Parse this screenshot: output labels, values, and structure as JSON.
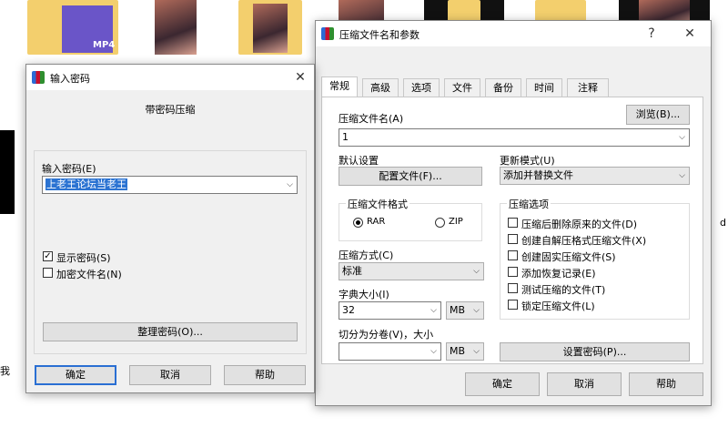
{
  "desktop": {
    "file_label": "MP4",
    "side_chars": [
      "d",
      "我"
    ]
  },
  "password_dialog": {
    "title": "输入密码",
    "heading": "带密码压缩",
    "password_label": "输入密码(E)",
    "password_value": "上老王论坛当老王",
    "show_password_label": "显示密码(S)",
    "show_password_checked": true,
    "encrypt_names_label": "加密文件名(N)",
    "encrypt_names_checked": false,
    "organize_button": "整理密码(O)...",
    "ok_button": "确定",
    "cancel_button": "取消",
    "help_button": "帮助",
    "close_glyph": "✕"
  },
  "archive_dialog": {
    "title": "压缩文件名和参数",
    "help_glyph": "?",
    "close_glyph": "✕",
    "tabs": [
      "常规",
      "高级",
      "选项",
      "文件",
      "备份",
      "时间",
      "注释"
    ],
    "archive_name_label": "压缩文件名(A)",
    "browse_button": "浏览(B)...",
    "archive_name_value": "1",
    "default_settings_label": "默认设置",
    "profiles_button": "配置文件(F)...",
    "update_mode_label": "更新模式(U)",
    "update_mode_value": "添加并替换文件",
    "format_group_label": "压缩文件格式",
    "format_rar": "RAR",
    "format_zip": "ZIP",
    "format_selected": "RAR",
    "method_label": "压缩方式(C)",
    "method_value": "标准",
    "dict_label": "字典大小(I)",
    "dict_value": "32",
    "dict_unit": "MB",
    "split_label": "切分为分卷(V)，大小",
    "split_value": "",
    "split_unit": "MB",
    "options_group_label": "压缩选项",
    "options": [
      {
        "label": "压缩后删除原来的文件(D)",
        "checked": false
      },
      {
        "label": "创建自解压格式压缩文件(X)",
        "checked": false
      },
      {
        "label": "创建固实压缩文件(S)",
        "checked": false
      },
      {
        "label": "添加恢复记录(E)",
        "checked": false
      },
      {
        "label": "测试压缩的文件(T)",
        "checked": false
      },
      {
        "label": "锁定压缩文件(L)",
        "checked": false
      }
    ],
    "set_password_button": "设置密码(P)...",
    "ok_button": "确定",
    "cancel_button": "取消",
    "help_button": "帮助"
  }
}
